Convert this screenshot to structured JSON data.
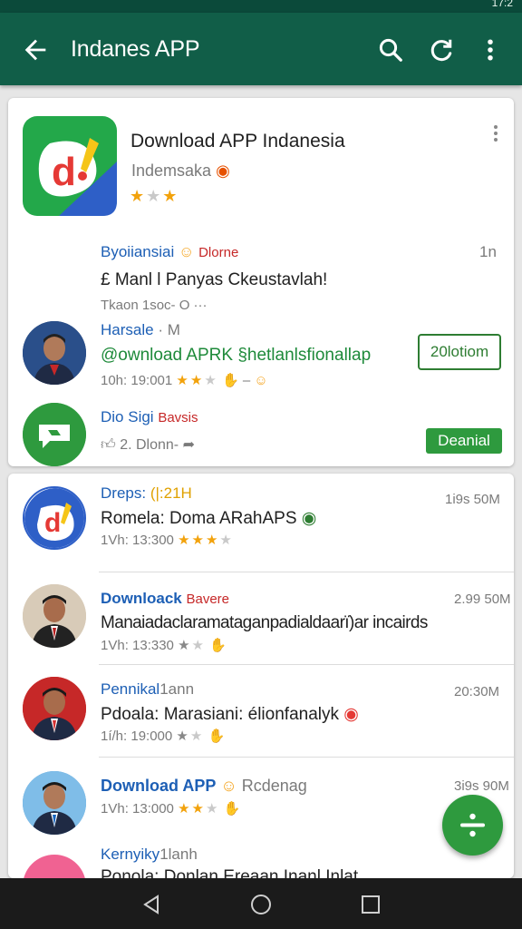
{
  "status_bar": {
    "left_text": "        ",
    "right_text": "17:2"
  },
  "app_bar": {
    "title": "Indanes APP",
    "back_icon": "arrow-left-icon",
    "search_icon": "search-icon",
    "refresh_icon": "refresh-icon",
    "more_icon": "more-vert-icon"
  },
  "featured": {
    "title": "Download APP Indanesia",
    "developer": "Indemsaka",
    "rating_stars": 2.5,
    "comment1": {
      "name": "Byoiiansiai",
      "tag": "Dlorne",
      "time": "1n",
      "text": "£ Manl l Panyas Ckeustavlah!",
      "meta": "Tkaon 1soc- O ···"
    },
    "comment2": {
      "name": "Harsale",
      "name_suffix": "· M",
      "text": "@ownload APRK §hetlanlsfionallap",
      "meta_left": "10h: 19:001",
      "meta_right": "–",
      "button": "20lotiom"
    },
    "comment3": {
      "name": "Dio Sigi",
      "tag": "Bavsis",
      "meta": "2. Dlonn-",
      "button": "Deanial"
    }
  },
  "list_items": [
    {
      "name": "Dreps:",
      "badge": "(|:21H",
      "size": "1i9s 50M",
      "text": "Romela: Doma ARahAPS",
      "meta": "1Vh: 13:300",
      "stars": 3
    },
    {
      "name": "Downloack",
      "badge": "Bavere",
      "size": "2.99 50M",
      "text": "Manaiadaclaramataganpadialdaarï)ar incairds",
      "meta": "1Vh: 13:330",
      "stars": 1
    },
    {
      "name": "Pennikal",
      "badge": "1ann",
      "size": "20:30M",
      "text": "Pdoala: Marasiani: élionfanalyk",
      "meta": "1í/h: 19:000",
      "stars": 1
    },
    {
      "name": "Download APP",
      "badge": "Rcdenag",
      "size": "3i9s 90M",
      "text": "",
      "meta": "1Vh: 13:000",
      "stars": 2
    },
    {
      "name": "Kernyiky",
      "badge": "1lanh",
      "size": "",
      "text": "Ponola: Donlan Ereaan Inanl Inlat",
      "meta": "",
      "stars": 0
    }
  ],
  "fab": {
    "icon": "divide-icon"
  },
  "nav_bar": {
    "back_icon": "nav-back-icon",
    "home_icon": "nav-home-icon",
    "recents_icon": "nav-recents-icon"
  },
  "colors": {
    "app_bar": "#115e48",
    "accent_green": "#2e9a3e",
    "link_blue": "#1d5fb5",
    "star": "#f2a20c"
  }
}
